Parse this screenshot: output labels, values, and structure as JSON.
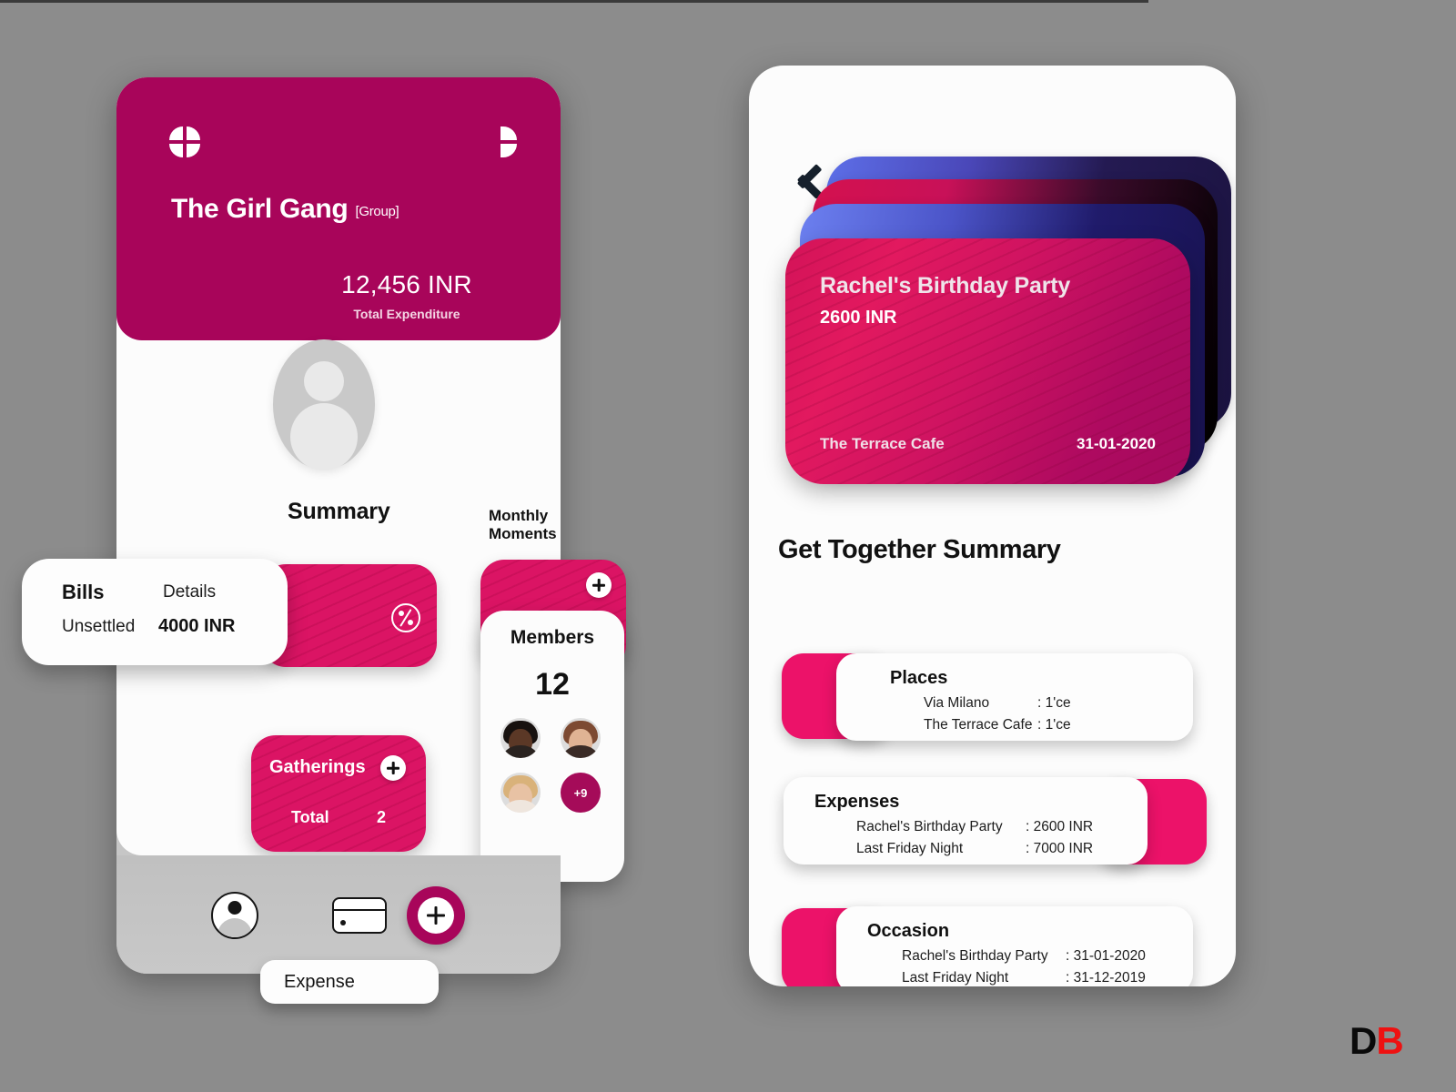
{
  "colors": {
    "brand_magenta": "#a8055a",
    "brand_pink": "#db1464",
    "accent_pink": "#ec1269",
    "background_grey": "#8c8c8c",
    "card_white": "#fcfcfc"
  },
  "left_phone": {
    "header": {
      "grid_icon": "grid-circle-icon",
      "half_icon": "half-circle-icon",
      "group_name": "The Girl Gang",
      "group_tag": "[Group]",
      "total_amount": "12,456 INR",
      "total_label": "Total Expenditure"
    },
    "sections": {
      "summary_label": "Summary",
      "moments_label": "Monthly Moments"
    },
    "bills_card": {
      "title": "Bills",
      "details_label": "Details",
      "status_label": "Unsettled",
      "amount": "4000 INR",
      "badge_icon": "percent-icon"
    },
    "gatherings_card": {
      "title": "Gatherings",
      "total_label": "Total",
      "total_value": "2",
      "add_icon": "plus-icon"
    },
    "members_card": {
      "title": "Members",
      "count": "12",
      "add_icon": "plus-icon",
      "overflow_label": "+9",
      "avatars": [
        {
          "name": "member-avatar-1",
          "skin": "#5b3826",
          "hair": "#17110f",
          "shoulder": "#2a2320"
        },
        {
          "name": "member-avatar-2",
          "skin": "#e0b394",
          "hair": "#7d4a32",
          "shoulder": "#3a2b26"
        },
        {
          "name": "member-avatar-3",
          "skin": "#e8c2a4",
          "hair": "#d9b27a",
          "shoulder": "#efe6de"
        }
      ]
    },
    "navbar": {
      "profile_icon": "profile-icon",
      "card_icon": "card-icon",
      "add_icon": "plus-icon"
    },
    "tooltip": {
      "label": "Expense"
    }
  },
  "right_phone": {
    "back_icon": "chevron-left-icon",
    "front_card": {
      "title": "Rachel's Birthday Party",
      "amount": "2600 INR",
      "place": "The Terrace Cafe",
      "date": "31-01-2020"
    },
    "summary_title": "Get Together Summary",
    "blocks": [
      {
        "heading": "Places",
        "rows": [
          {
            "key": "Via Milano",
            "value": ": 1'ce"
          },
          {
            "key": "The Terrace Cafe",
            "value": ": 1'ce"
          }
        ]
      },
      {
        "heading": "Expenses",
        "rows": [
          {
            "key": "Rachel's Birthday Party",
            "value": ": 2600 INR"
          },
          {
            "key": "Last Friday Night",
            "value": ": 7000 INR"
          }
        ]
      },
      {
        "heading": "Occasion",
        "rows": [
          {
            "key": "Rachel's Birthday Party",
            "value": ": 31-01-2020"
          },
          {
            "key": "Last Friday Night",
            "value": ": 31-12-2019"
          }
        ]
      }
    ]
  },
  "watermark": {
    "first": "D",
    "second": "B"
  }
}
